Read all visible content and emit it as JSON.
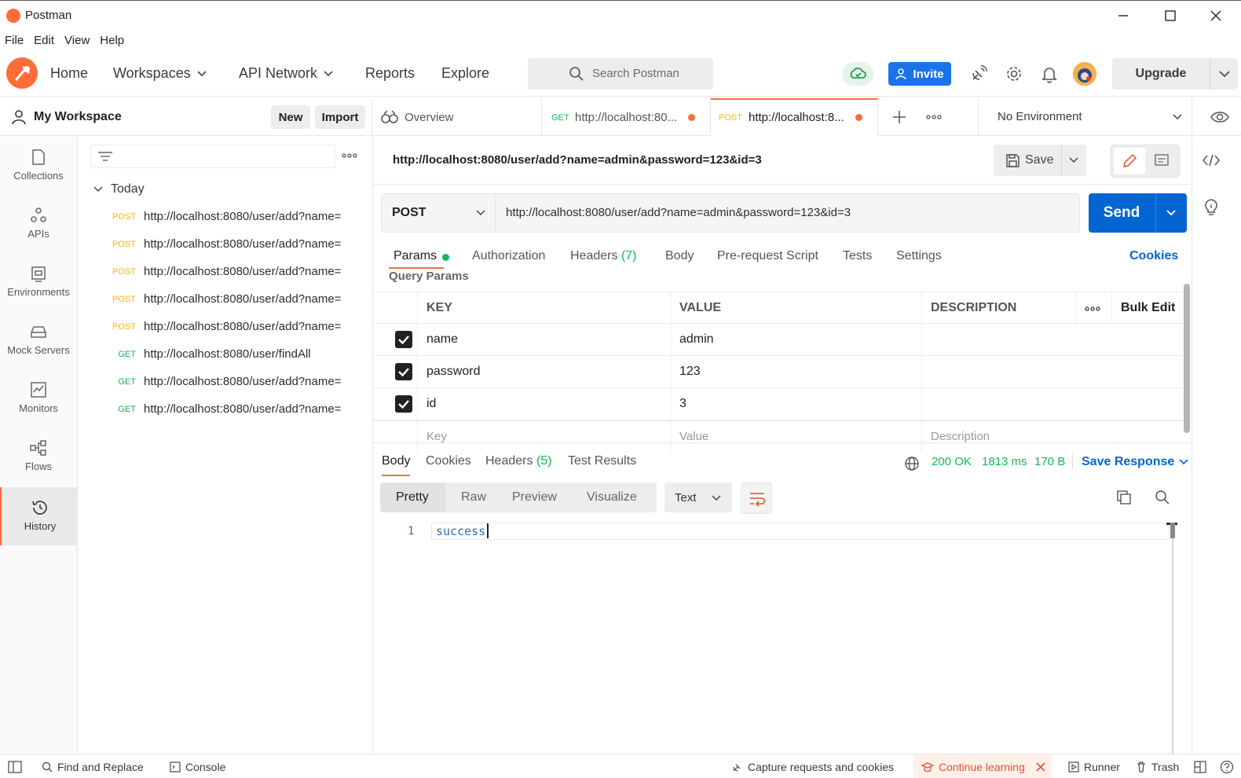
{
  "window": {
    "title": "Postman"
  },
  "menu": [
    "File",
    "Edit",
    "View",
    "Help"
  ],
  "nav": {
    "home": "Home",
    "workspaces": "Workspaces",
    "api_network": "API Network",
    "reports": "Reports",
    "explore": "Explore",
    "search_placeholder": "Search Postman",
    "invite": "Invite",
    "upgrade": "Upgrade"
  },
  "workspace": {
    "name": "My Workspace",
    "new": "New",
    "import": "Import"
  },
  "rail": [
    "Collections",
    "APIs",
    "Environments",
    "Mock Servers",
    "Monitors",
    "Flows",
    "History"
  ],
  "history": {
    "group": "Today",
    "items": [
      {
        "method": "POST",
        "url": "http://localhost:8080/user/add?name="
      },
      {
        "method": "POST",
        "url": "http://localhost:8080/user/add?name="
      },
      {
        "method": "POST",
        "url": "http://localhost:8080/user/add?name="
      },
      {
        "method": "POST",
        "url": "http://localhost:8080/user/add?name="
      },
      {
        "method": "POST",
        "url": "http://localhost:8080/user/add?name="
      },
      {
        "method": "GET",
        "url": "http://localhost:8080/user/findAll"
      },
      {
        "method": "GET",
        "url": "http://localhost:8080/user/add?name="
      },
      {
        "method": "GET",
        "url": "http://localhost:8080/user/add?name="
      }
    ]
  },
  "tabs": {
    "overview": "Overview",
    "tab1": {
      "method": "GET",
      "url": "http://localhost:80..."
    },
    "tab2": {
      "method": "POST",
      "url": "http://localhost:8..."
    },
    "environment": "No Environment"
  },
  "request": {
    "title": "http://localhost:8080/user/add?name=admin&password=123&id=3",
    "save": "Save",
    "method": "POST",
    "url": "http://localhost:8080/user/add?name=admin&password=123&id=3",
    "send": "Send"
  },
  "subtabs": {
    "params": "Params",
    "authorization": "Authorization",
    "headers": "Headers",
    "headers_count": "(7)",
    "body": "Body",
    "prerequest": "Pre-request Script",
    "tests": "Tests",
    "settings": "Settings",
    "cookies": "Cookies"
  },
  "query_params": {
    "title": "Query Params",
    "headers": {
      "key": "KEY",
      "value": "VALUE",
      "description": "DESCRIPTION",
      "bulk_edit": "Bulk Edit"
    },
    "rows": [
      {
        "key": "name",
        "value": "admin",
        "checked": true
      },
      {
        "key": "password",
        "value": "123",
        "checked": true
      },
      {
        "key": "id",
        "value": "3",
        "checked": true
      }
    ],
    "placeholders": {
      "key": "Key",
      "value": "Value",
      "description": "Description"
    }
  },
  "response": {
    "tabs": {
      "body": "Body",
      "cookies": "Cookies",
      "headers": "Headers",
      "headers_count": "(5)",
      "test_results": "Test Results"
    },
    "status": "200 OK",
    "time": "1813 ms",
    "size": "170 B",
    "save_response": "Save Response",
    "views": [
      "Pretty",
      "Raw",
      "Preview",
      "Visualize"
    ],
    "format": "Text",
    "line_number": "1",
    "body": "success"
  },
  "statusbar": {
    "find_replace": "Find and Replace",
    "console": "Console",
    "capture": "Capture requests and cookies",
    "continue_learning": "Continue learning",
    "runner": "Runner",
    "trash": "Trash"
  },
  "colors": {
    "accent": "#ff6c37",
    "primary": "#0265d2",
    "post": "#ffb400",
    "get": "#0cbb52"
  }
}
